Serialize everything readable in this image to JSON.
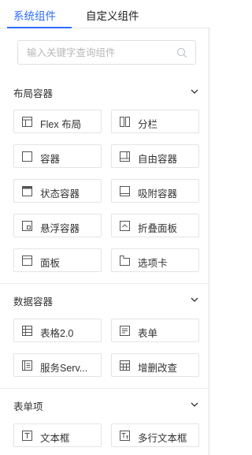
{
  "tabs": [
    {
      "label": "系统组件",
      "active": true
    },
    {
      "label": "自定义组件",
      "active": false
    }
  ],
  "search": {
    "placeholder": "输入关键字查询组件",
    "value": ""
  },
  "accent_color": "#2f6bff",
  "sections": [
    {
      "title": "布局容器",
      "expanded": true,
      "items": [
        {
          "label": "Flex 布局",
          "icon": "flex-layout-icon"
        },
        {
          "label": "分栏",
          "icon": "columns-icon"
        },
        {
          "label": "容器",
          "icon": "container-icon"
        },
        {
          "label": "自由容器",
          "icon": "free-container-icon"
        },
        {
          "label": "状态容器",
          "icon": "state-container-icon"
        },
        {
          "label": "吸附容器",
          "icon": "sticky-container-icon"
        },
        {
          "label": "悬浮容器",
          "icon": "floating-container-icon"
        },
        {
          "label": "折叠面板",
          "icon": "collapse-panel-icon"
        },
        {
          "label": "面板",
          "icon": "panel-icon"
        },
        {
          "label": "选项卡",
          "icon": "tabs-icon"
        }
      ]
    },
    {
      "title": "数据容器",
      "expanded": true,
      "items": [
        {
          "label": "表格2.0",
          "icon": "table-icon"
        },
        {
          "label": "表单",
          "icon": "form-icon"
        },
        {
          "label": "服务Serv...",
          "icon": "service-icon"
        },
        {
          "label": "增删改查",
          "icon": "crud-icon"
        }
      ]
    },
    {
      "title": "表单项",
      "expanded": true,
      "items": [
        {
          "label": "文本框",
          "icon": "text-input-icon"
        },
        {
          "label": "多行文本框",
          "icon": "textarea-icon"
        }
      ]
    }
  ]
}
